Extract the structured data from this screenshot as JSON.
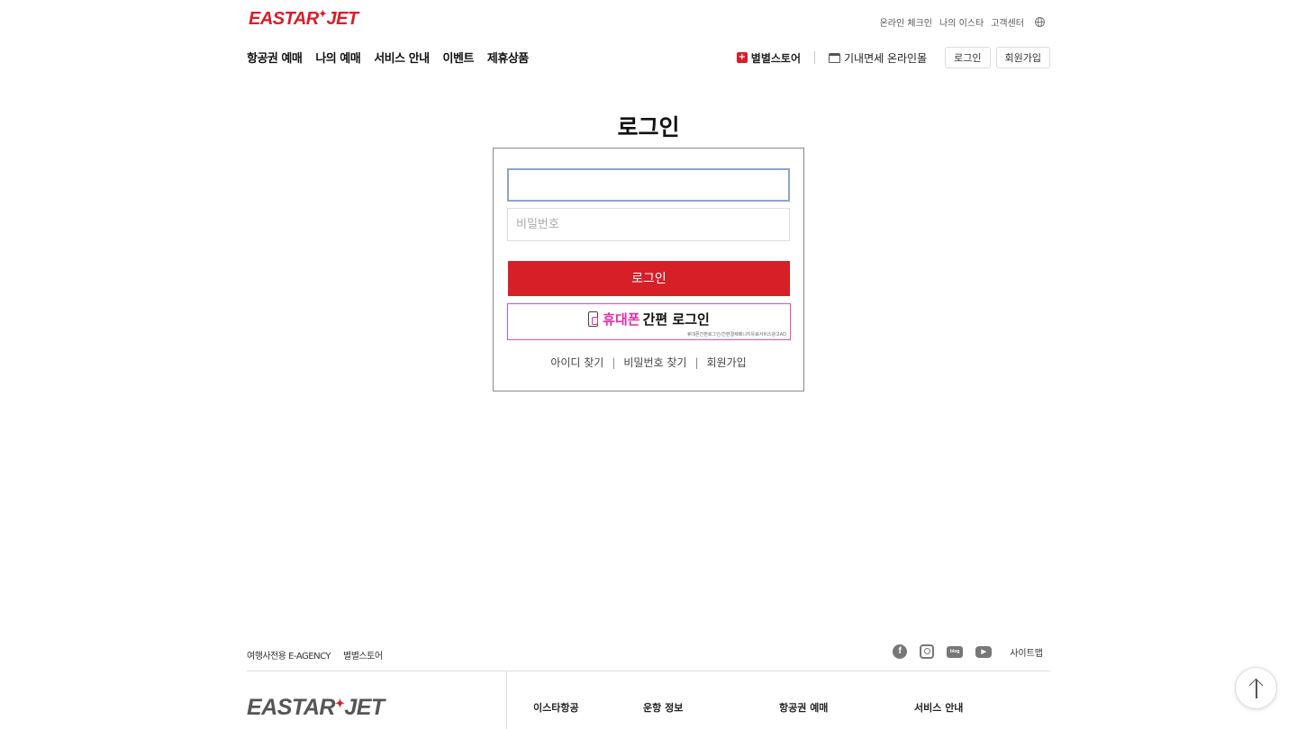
{
  "brand": {
    "logo_left": "EASTAR",
    "logo_star": "✦",
    "logo_right": "JET"
  },
  "util_nav": [
    "온라인 체크인",
    "나의 이스타",
    "고객센터"
  ],
  "gnb": [
    "항공권 예매",
    "나의 예매",
    "서비스 안내",
    "이벤트",
    "제휴상품"
  ],
  "right_nav": {
    "store_icon": "+",
    "store": "별별스토어",
    "duty_free": "기내면세 온라인몰",
    "login": "로그인",
    "signup": "회원가입"
  },
  "login": {
    "title": "로그인",
    "id_placeholder": "",
    "password_placeholder": "비밀번호",
    "login_button": "로그인",
    "phone_login_highlight": "휴대폰",
    "phone_login_rest": "간편 로그인",
    "phone_login_note": "휴대폰간편로그인/간편결제페니지유료서비스광고AD",
    "links": [
      "아이디 찾기",
      "비밀번호 찾기",
      "회원가입"
    ],
    "link_separator": "|"
  },
  "footer": {
    "top_links": [
      "여행사전용 E-AGENCY",
      "별별스토어"
    ],
    "social": {
      "facebook": "f",
      "blog": "blog",
      "youtube": "▶"
    },
    "sitemap": "사이트맵",
    "columns": [
      "이스타항공",
      "운항 정보",
      "항공권 예매",
      "서비스 안내"
    ]
  },
  "colors": {
    "brand_red": "#d61f26",
    "phone_pink": "#e02ea6"
  }
}
